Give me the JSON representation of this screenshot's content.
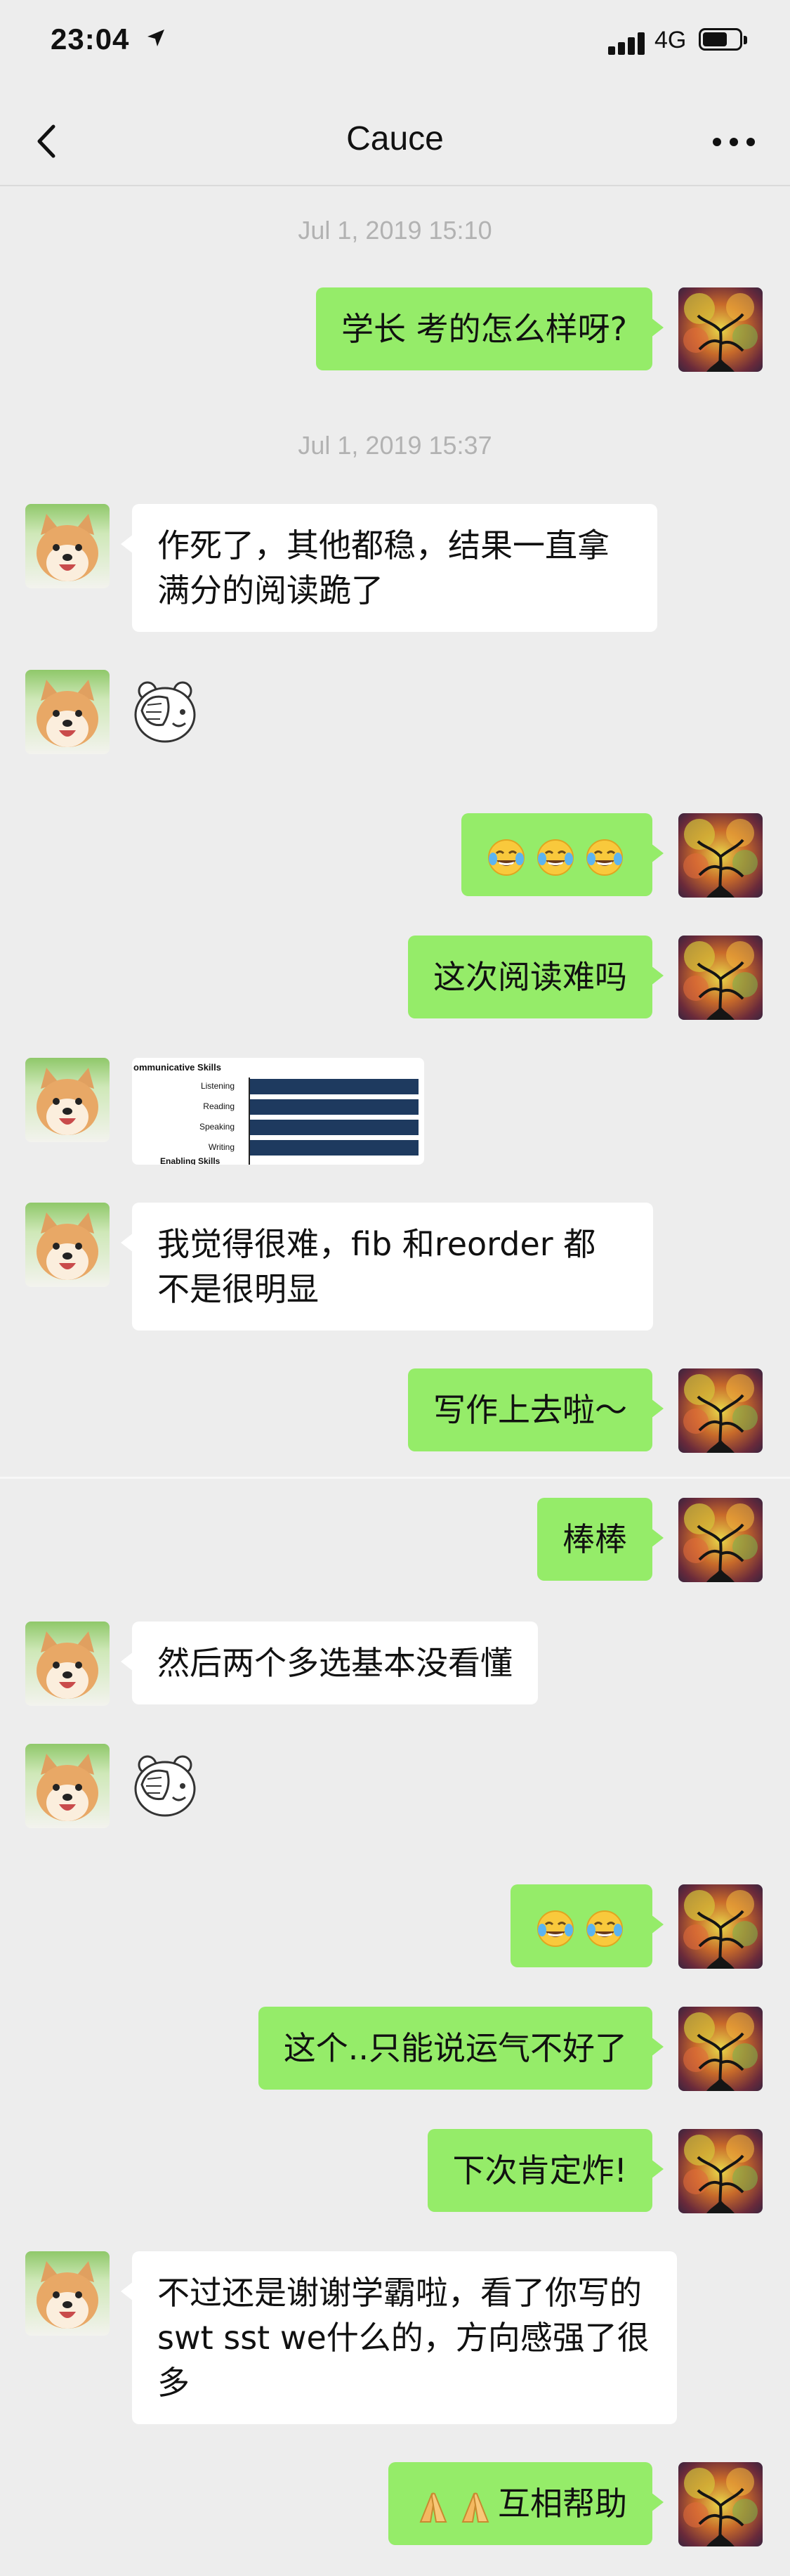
{
  "status_bar": {
    "time": "23:04",
    "network": "4G"
  },
  "nav": {
    "title": "Cauce"
  },
  "messages": [
    {
      "type": "time",
      "text": "Jul 1, 2019 15:10"
    },
    {
      "type": "me",
      "text": "学长 考的怎么样呀?"
    },
    {
      "type": "time",
      "text": "Jul 1, 2019 15:37"
    },
    {
      "type": "other",
      "text": "作死了，其他都稳，结果一直拿满分的阅读跪了"
    },
    {
      "type": "other-sticker",
      "sticker": "facepalm-bear"
    },
    {
      "type": "me-emoji",
      "emojis": [
        "face-with-tears-of-joy",
        "face-with-tears-of-joy",
        "face-with-tears-of-joy"
      ]
    },
    {
      "type": "me",
      "text": "这次阅读难吗"
    },
    {
      "type": "other-image",
      "title": "ommunicative Skills",
      "rows": [
        "Listening",
        "Reading",
        "Speaking",
        "Writing"
      ],
      "footer": "Enabling Skills"
    },
    {
      "type": "other",
      "text": "我觉得很难，fib 和reorder 都不是很明显"
    },
    {
      "type": "me",
      "text": "写作上去啦～"
    },
    {
      "type": "me",
      "text": "棒棒"
    },
    {
      "type": "other",
      "text": "然后两个多选基本没看懂"
    },
    {
      "type": "other-sticker",
      "sticker": "facepalm-bear"
    },
    {
      "type": "me-emoji",
      "emojis": [
        "face-with-tears-of-joy",
        "face-with-tears-of-joy"
      ]
    },
    {
      "type": "me",
      "text": "这个..只能说运气不好了"
    },
    {
      "type": "me",
      "text": "下次肯定炸!"
    },
    {
      "type": "other",
      "text": "不过还是谢谢学霸啦，看了你写的swt sst we什么的，方向感强了很多"
    },
    {
      "type": "me",
      "text": "互相帮助",
      "prefix_emojis": [
        "folded-hands",
        "folded-hands"
      ]
    }
  ],
  "colors": {
    "background": "#ededed",
    "my_bubble": "#95ec69",
    "other_bubble": "#ffffff",
    "time_label": "#b2b2b2"
  },
  "icons": [
    "location-arrow-icon",
    "signal-icon",
    "battery-icon",
    "back-chevron-icon",
    "more-dots-icon"
  ]
}
